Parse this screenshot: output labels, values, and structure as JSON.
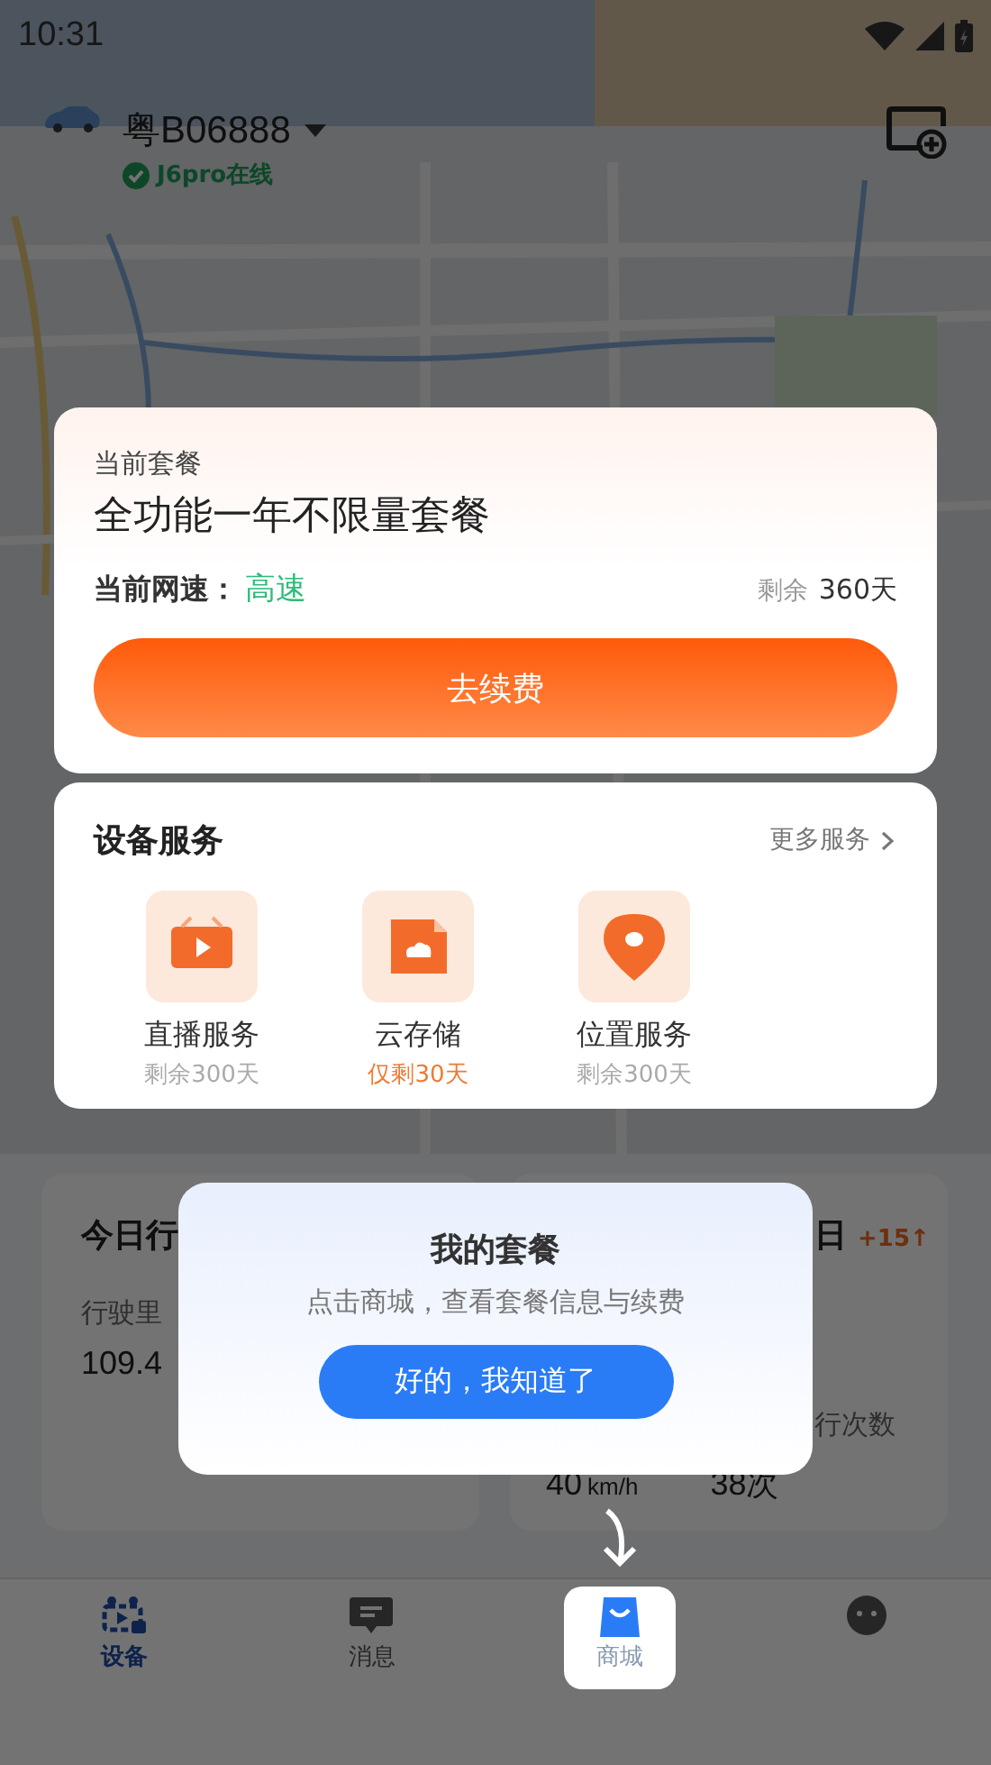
{
  "status_bar": {
    "time": "10:31"
  },
  "vehicle": {
    "plate": "粤B06888",
    "device_status": "J6pro在线",
    "online": true
  },
  "trip_card": {
    "title": "今日行",
    "mileage_label": "行驶里",
    "mileage": "109.4"
  },
  "stats_card": {
    "title": "日",
    "change": "+15↑",
    "trips_label": "行次数",
    "speed": "40",
    "speed_unit": "km/h",
    "trips": "38次"
  },
  "plan_card": {
    "label": "当前套餐",
    "name": "全功能一年不限量套餐",
    "speed_label": "当前网速：",
    "speed": "高速",
    "remaining_label": "剩余",
    "remaining": "360天",
    "button": "去续费"
  },
  "services": {
    "title": "设备服务",
    "more": "更多服务",
    "items": [
      {
        "kind": "live",
        "name": "直播服务",
        "remaining": "剩余300天",
        "expiring": false
      },
      {
        "kind": "cloud",
        "name": "云存储",
        "remaining": "仅剩30天",
        "expiring": true
      },
      {
        "kind": "location",
        "name": "位置服务",
        "remaining": "剩余300天",
        "expiring": false
      }
    ]
  },
  "guide": {
    "title": "我的套餐",
    "text": "点击商城，查看套餐信息与续费",
    "button": "好的，我知道了"
  },
  "tabs": [
    {
      "kind": "device",
      "label": "设备",
      "selected": true,
      "spotlight": false
    },
    {
      "kind": "message",
      "label": "消息",
      "selected": false,
      "spotlight": false
    },
    {
      "kind": "mall",
      "label": "商城",
      "selected": false,
      "spotlight": true
    },
    {
      "kind": "profile",
      "selected": false,
      "spotlight": false
    }
  ]
}
